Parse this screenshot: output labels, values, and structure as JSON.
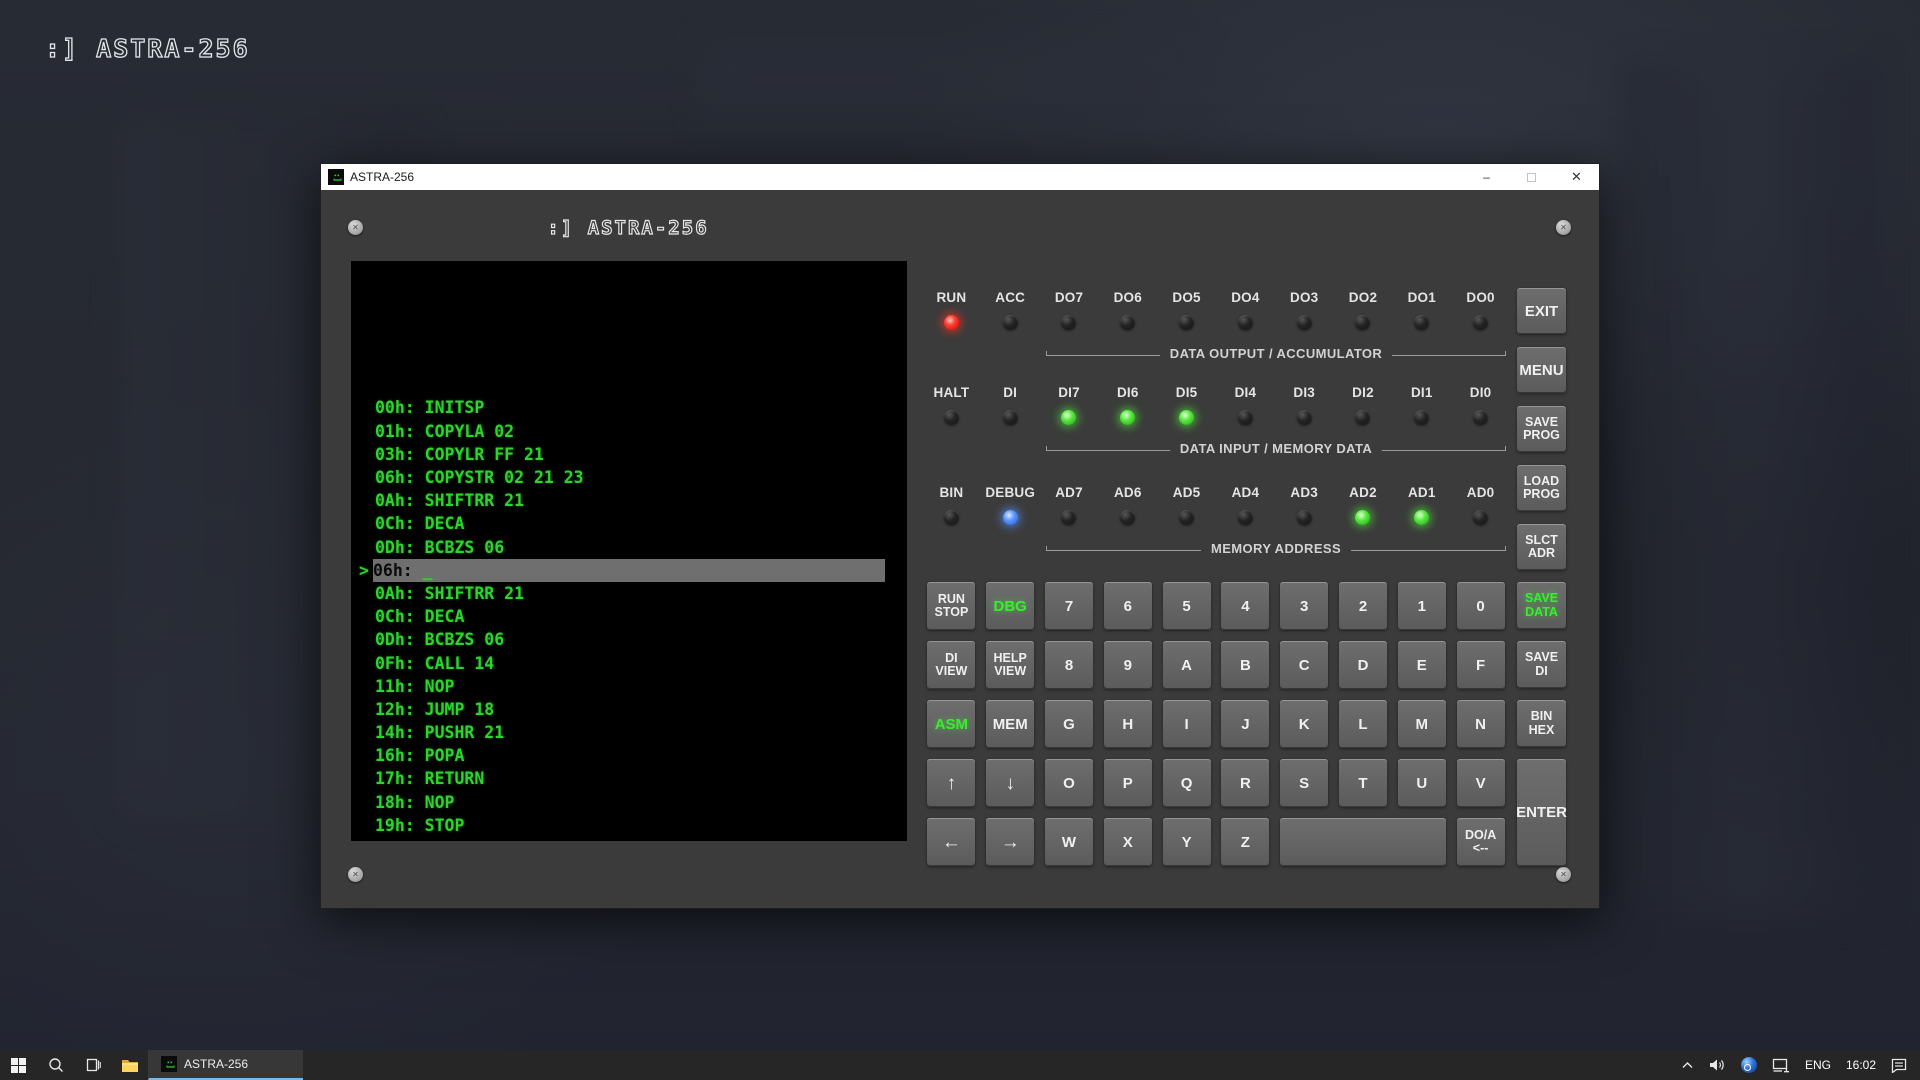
{
  "desktop": {
    "logo": ":] ASTRA-256"
  },
  "window": {
    "title": "ASTRA-256",
    "logo": ":] ASTRA-256",
    "min_glyph": "–",
    "close_glyph": "✕"
  },
  "icons": {
    "screw_glyph": "✕",
    "smiley": ":]"
  },
  "terminal": {
    "lines": [
      "00h: INITSP",
      "01h: COPYLA 02",
      "03h: COPYLR FF 21",
      "06h: COPYSTR 02 21 23",
      "0Ah: SHIFTRR 21",
      "0Ch: DECA",
      "0Dh: BCBZS 06",
      "06h:",
      "0Ah: SHIFTRR 21",
      "0Ch: DECA",
      "0Dh: BCBZS 06",
      "0Fh: CALL 14",
      "11h: NOP",
      "12h: JUMP 18",
      "14h: PUSHR 21",
      "16h: POPA",
      "17h: RETURN",
      "18h: NOP",
      "19h: STOP"
    ],
    "active_line_index": 7,
    "active_prompt": ">",
    "active_text": "06h:",
    "cursor": "_"
  },
  "led_panel": {
    "rows": [
      {
        "leds": [
          {
            "label": "RUN",
            "state": "red"
          },
          {
            "label": "ACC",
            "state": "off"
          },
          {
            "label": "DO7",
            "state": "off"
          },
          {
            "label": "DO6",
            "state": "off"
          },
          {
            "label": "DO5",
            "state": "off"
          },
          {
            "label": "DO4",
            "state": "off"
          },
          {
            "label": "DO3",
            "state": "off"
          },
          {
            "label": "DO2",
            "state": "off"
          },
          {
            "label": "DO1",
            "state": "off"
          },
          {
            "label": "DO0",
            "state": "off"
          }
        ],
        "bracket_label": "DATA OUTPUT / ACCUMULATOR"
      },
      {
        "leds": [
          {
            "label": "HALT",
            "state": "off"
          },
          {
            "label": "DI",
            "state": "off"
          },
          {
            "label": "DI7",
            "state": "green"
          },
          {
            "label": "DI6",
            "state": "green"
          },
          {
            "label": "DI5",
            "state": "green"
          },
          {
            "label": "DI4",
            "state": "off"
          },
          {
            "label": "DI3",
            "state": "off"
          },
          {
            "label": "DI2",
            "state": "off"
          },
          {
            "label": "DI1",
            "state": "off"
          },
          {
            "label": "DI0",
            "state": "off"
          }
        ],
        "bracket_label": "DATA INPUT / MEMORY DATA"
      },
      {
        "leds": [
          {
            "label": "BIN",
            "state": "off"
          },
          {
            "label": "DEBUG",
            "state": "blue"
          },
          {
            "label": "AD7",
            "state": "off"
          },
          {
            "label": "AD6",
            "state": "off"
          },
          {
            "label": "AD5",
            "state": "off"
          },
          {
            "label": "AD4",
            "state": "off"
          },
          {
            "label": "AD3",
            "state": "off"
          },
          {
            "label": "AD2",
            "state": "green"
          },
          {
            "label": "AD1",
            "state": "green"
          },
          {
            "label": "AD0",
            "state": "off"
          }
        ],
        "bracket_label": "MEMORY ADDRESS"
      }
    ]
  },
  "keypad": {
    "rows": [
      [
        {
          "label": "RUN\nSTOP"
        },
        {
          "label": "DBG",
          "accent": true
        },
        {
          "label": "7"
        },
        {
          "label": "6"
        },
        {
          "label": "5"
        },
        {
          "label": "4"
        },
        {
          "label": "3"
        },
        {
          "label": "2"
        },
        {
          "label": "1"
        },
        {
          "label": "0"
        }
      ],
      [
        {
          "label": "DI\nVIEW"
        },
        {
          "label": "HELP\nVIEW"
        },
        {
          "label": "8"
        },
        {
          "label": "9"
        },
        {
          "label": "A"
        },
        {
          "label": "B"
        },
        {
          "label": "C"
        },
        {
          "label": "D"
        },
        {
          "label": "E"
        },
        {
          "label": "F"
        }
      ],
      [
        {
          "label": "ASM",
          "accent": true
        },
        {
          "label": "MEM"
        },
        {
          "label": "G"
        },
        {
          "label": "H"
        },
        {
          "label": "I"
        },
        {
          "label": "J"
        },
        {
          "label": "K"
        },
        {
          "label": "L"
        },
        {
          "label": "M"
        },
        {
          "label": "N"
        }
      ],
      [
        {
          "label": "↑",
          "name": "up"
        },
        {
          "label": "↓",
          "name": "down"
        },
        {
          "label": "O"
        },
        {
          "label": "P"
        },
        {
          "label": "Q"
        },
        {
          "label": "R"
        },
        {
          "label": "S"
        },
        {
          "label": "T"
        },
        {
          "label": "U"
        },
        {
          "label": "V"
        }
      ],
      [
        {
          "label": "←",
          "name": "left"
        },
        {
          "label": "→",
          "name": "right"
        },
        {
          "label": "W"
        },
        {
          "label": "X"
        },
        {
          "label": "Y"
        },
        {
          "label": "Z"
        },
        {
          "label": "",
          "name": "space",
          "span": 3
        },
        {
          "label": "DO/A\n<--",
          "name": "do-a"
        }
      ]
    ]
  },
  "side_buttons": [
    {
      "label": "EXIT"
    },
    {
      "label": "MENU"
    },
    {
      "label": "SAVE\nPROG"
    },
    {
      "label": "LOAD\nPROG"
    },
    {
      "label": "SLCT\nADR"
    },
    {
      "label": "SAVE\nDATA",
      "accent": true
    },
    {
      "label": "SAVE\nDI"
    },
    {
      "label": "BIN\nHEX"
    },
    {
      "label": "ENTER",
      "tall": true
    }
  ],
  "taskbar": {
    "app_label": "ASTRA-256",
    "language": "ENG",
    "time": "16:02"
  },
  "colors": {
    "window_body": "#3b3b3b",
    "titlebar": "#ffffff",
    "terminal_green": "#2fd32f",
    "led_red": "#ff2a1e",
    "led_green": "#3fe02f",
    "led_blue": "#4b8dff",
    "accent_green": "#38ef2e",
    "taskbar_accent": "#76b9ed"
  }
}
